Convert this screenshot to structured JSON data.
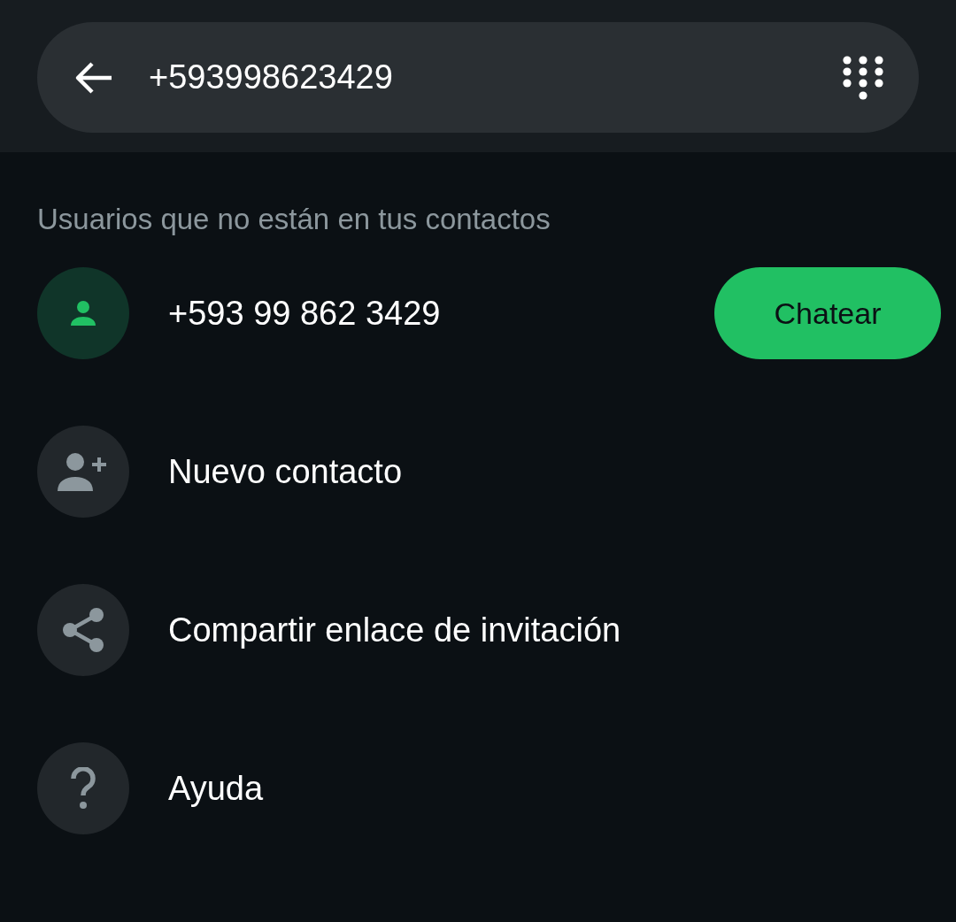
{
  "search": {
    "value": "+593998623429"
  },
  "section_label": "Usuarios que no están en tus contactos",
  "results": [
    {
      "kind": "contact",
      "number": "+593 99 862 3429",
      "action": "Chatear"
    }
  ],
  "actions": [
    {
      "kind": "new-contact",
      "label": "Nuevo contacto"
    },
    {
      "kind": "share",
      "label": "Compartir enlace de invitación"
    },
    {
      "kind": "help",
      "label": "Ayuda"
    }
  ]
}
